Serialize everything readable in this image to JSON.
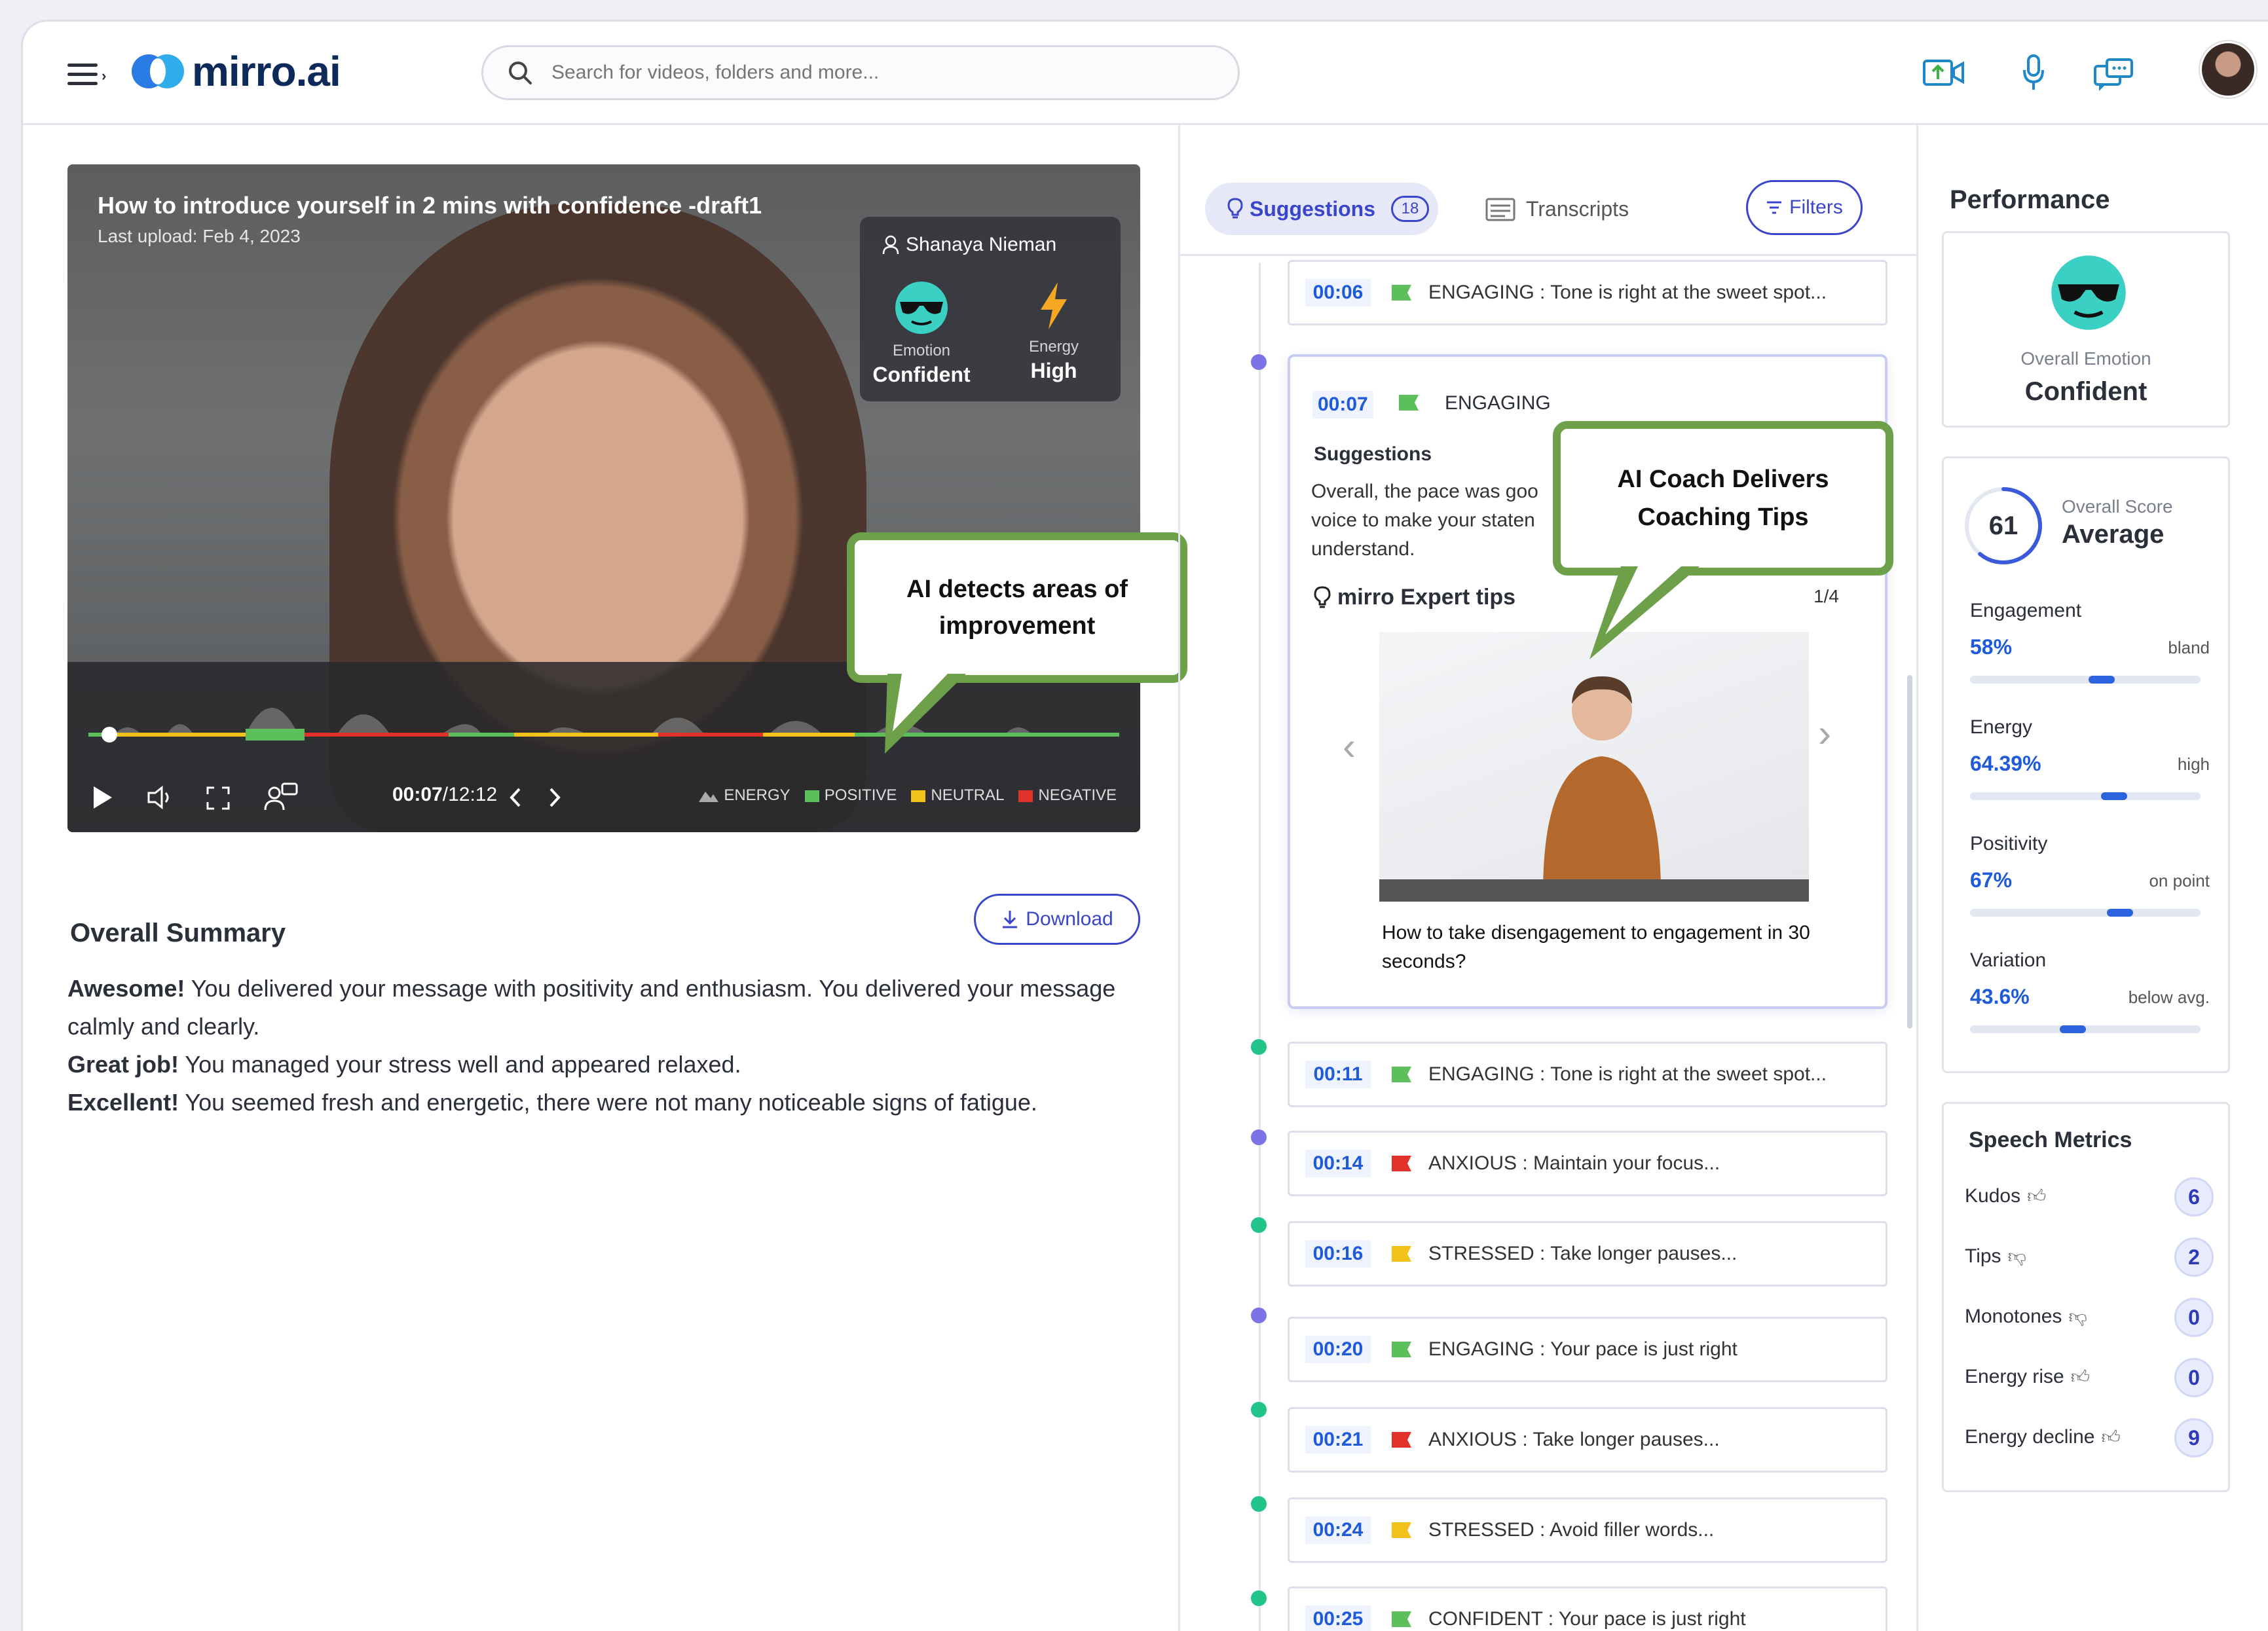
{
  "app": {
    "logo_text": "mirro.ai",
    "search_placeholder": "Search for videos, folders and more..."
  },
  "video": {
    "title": "How to introduce yourself in 2 mins with confidence -draft1",
    "last_upload": "Last upload: Feb 4,  2023",
    "person_name": "Shanaya Nieman",
    "emotion_label": "Emotion",
    "emotion_value": "Confident",
    "energy_label": "Energy",
    "energy_value": "High",
    "time_current": "00:07",
    "time_total": "/12:12",
    "legend": [
      "ENERGY",
      "POSITIVE",
      "NEUTRAL",
      "NEGATIVE"
    ],
    "callout": "AI detects areas of improvement"
  },
  "summary": {
    "title": "Overall Summary",
    "download_label": "Download",
    "lines": [
      {
        "lead": "Awesome!",
        "text": " You delivered your message with positivity and enthusiasm. You delivered your message calmly and clearly."
      },
      {
        "lead": "Great job!",
        "text": " You managed your stress well and appeared relaxed."
      },
      {
        "lead": "Excellent!",
        "text": " You seemed fresh and energetic, there were not many noticeable signs of fatigue."
      }
    ]
  },
  "suggestions": {
    "tab_label": "Suggestions",
    "tab_count": "18",
    "transcripts_label": "Transcripts",
    "filters_label": "Filters",
    "expanded": {
      "ts": "00:07",
      "label": "ENGAGING",
      "heading": "Suggestions",
      "text": "Overall, the pace was goo voice to make your staten understand.",
      "expert_title": "mirro Expert tips",
      "page": "1/4",
      "video_caption": "How to take disengagement to engagement in 30 seconds?",
      "callout": "AI Coach Delivers Coaching Tips"
    },
    "items": [
      {
        "ts": "00:06",
        "label": "ENGAGING : Tone is right at the sweet spot...",
        "color": "#5cbf5c"
      },
      {
        "ts": "00:11",
        "label": "ENGAGING : Tone is right at the sweet spot...",
        "color": "#5cbf5c"
      },
      {
        "ts": "00:14",
        "label": "ANXIOUS  : Maintain your focus...",
        "color": "#e0322b"
      },
      {
        "ts": "00:16",
        "label": "STRESSED : Take longer pauses...",
        "color": "#f2c21b"
      },
      {
        "ts": "00:20",
        "label": "ENGAGING   : Your pace is just right",
        "color": "#5cbf5c"
      },
      {
        "ts": "00:21",
        "label": "ANXIOUS : Take longer pauses...",
        "color": "#e0322b"
      },
      {
        "ts": "00:24",
        "label": "STRESSED  : Avoid filler words...",
        "color": "#f2c21b"
      },
      {
        "ts": "00:25",
        "label": "CONFIDENT  : Your pace is just right",
        "color": "#5cbf5c"
      }
    ]
  },
  "performance": {
    "title": "Performance",
    "overall_emotion_label": "Overall Emotion",
    "overall_emotion_value": "Confident",
    "score": "61",
    "score_fraction": 0.61,
    "score_label": "Overall Score",
    "score_value": "Average",
    "metrics": [
      {
        "name": "Engagement",
        "value": "58%",
        "tag": "bland",
        "level": 0.58
      },
      {
        "name": "Energy",
        "value": "64.39%",
        "tag": "high",
        "level": 0.64
      },
      {
        "name": "Positivity",
        "value": "67%",
        "tag": "on point",
        "level": 0.67
      },
      {
        "name": "Variation",
        "value": "43.6%",
        "tag": "below avg.",
        "level": 0.44
      }
    ]
  },
  "speech_metrics": {
    "title": "Speech Metrics",
    "rows": [
      {
        "label": "Kudos",
        "value": "6",
        "icon": "thumbs-up-icon"
      },
      {
        "label": "Tips",
        "value": "2",
        "icon": "thumbs-down-icon"
      },
      {
        "label": "Monotones",
        "value": "0",
        "icon": "thumbs-down-icon"
      },
      {
        "label": "Energy rise",
        "value": "0",
        "icon": "thumbs-up-icon"
      },
      {
        "label": "Energy decline",
        "value": "9",
        "icon": "thumbs-up-icon"
      }
    ]
  }
}
